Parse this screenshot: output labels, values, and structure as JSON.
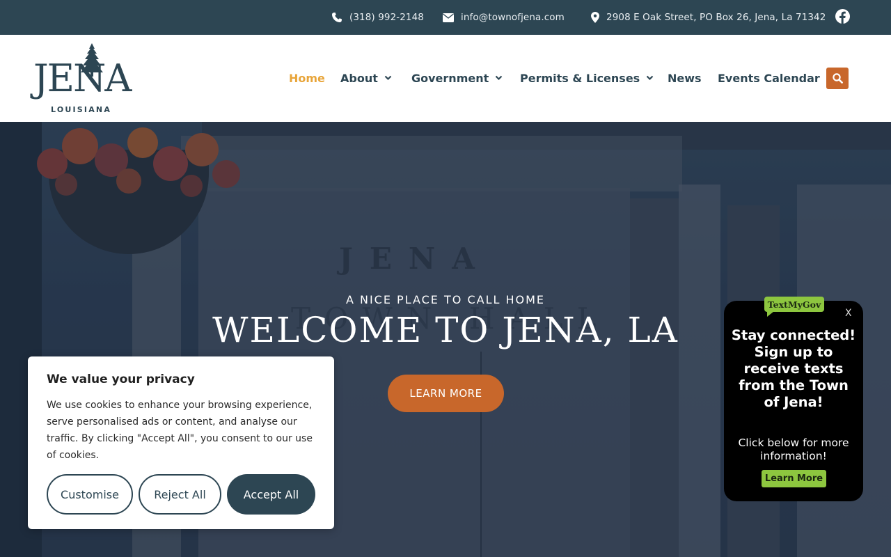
{
  "topbar": {
    "phone": "(318) 992-2148",
    "email": "info@townofjena.com",
    "address": "2908 E Oak Street, PO Box 26, Jena, La 71342",
    "facebook_icon": "facebook-icon"
  },
  "logo": {
    "word": "JENA",
    "sub": "LOUISIANA"
  },
  "nav": {
    "items": [
      {
        "label": "Home",
        "active": true
      },
      {
        "label": "About",
        "has_dropdown": true
      },
      {
        "label": "Government",
        "has_dropdown": true
      },
      {
        "label": "Permits & Licenses",
        "has_dropdown": true
      },
      {
        "label": "News"
      },
      {
        "label": "Events Calendar"
      }
    ],
    "search_icon": "search-icon"
  },
  "hero": {
    "sign_line1": "JENA",
    "sign_line2": "TOWN HALL",
    "kicker": "A NICE PLACE TO CALL HOME",
    "title": "WELCOME TO JENA, LA",
    "button": "LEARN MORE"
  },
  "cookie": {
    "title": "We value your privacy",
    "body": "We use cookies to enhance your browsing experience, serve personalised ads or content, and analyse our traffic. By clicking \"Accept All\", you consent to our use of cookies.",
    "customise": "Customise",
    "reject": "Reject All",
    "accept": "Accept All"
  },
  "textmygov": {
    "badge": "TextMyGov",
    "close": "X",
    "headline": "Stay connected! Sign up to receive texts from the Town of Jena!",
    "sub": "Click below for more information!",
    "button": "Learn More"
  },
  "colors": {
    "navy": "#2d4653",
    "accent_orange": "#c8672b",
    "active_gold": "#e8a53a",
    "tmg_green": "#8dc63f"
  }
}
